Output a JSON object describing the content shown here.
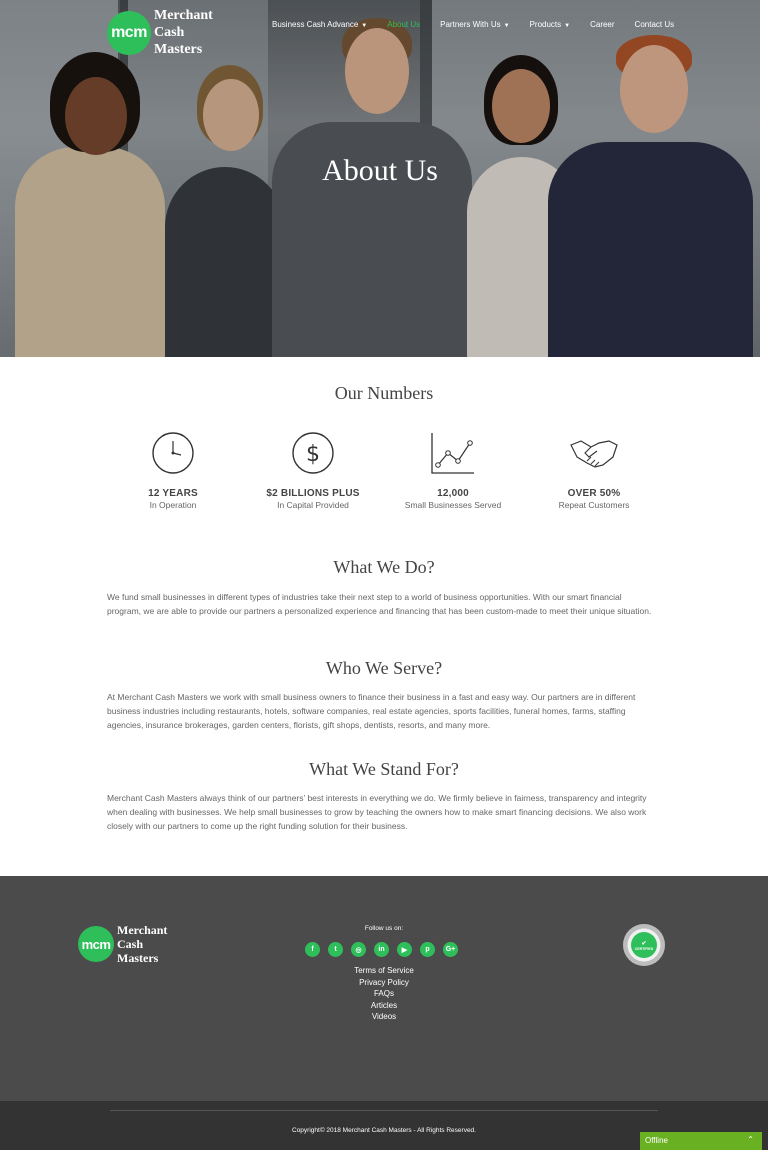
{
  "brand": {
    "logo_text": "mcm",
    "name_line1": "Merchant",
    "name_line2": "Cash",
    "name_line3": "Masters"
  },
  "nav": [
    {
      "label": "Business Cash Advance",
      "has_dropdown": true,
      "active": false
    },
    {
      "label": "About Us",
      "has_dropdown": false,
      "active": true
    },
    {
      "label": "Partners With Us",
      "has_dropdown": true,
      "active": false
    },
    {
      "label": "Products",
      "has_dropdown": true,
      "active": false
    },
    {
      "label": "Career",
      "has_dropdown": false,
      "active": false
    },
    {
      "label": "Contact Us",
      "has_dropdown": false,
      "active": false
    }
  ],
  "hero": {
    "title": "About Us"
  },
  "numbers": {
    "title": "Our Numbers",
    "stats": [
      {
        "icon": "clock-icon",
        "value": "12 YEARS",
        "label": "In Operation"
      },
      {
        "icon": "dollar-icon",
        "value": "$2 BILLIONS PLUS",
        "label": "In Capital Provided"
      },
      {
        "icon": "growth-chart-icon",
        "value": "12,000",
        "label": "Small Businesses Served"
      },
      {
        "icon": "handshake-icon",
        "value": "OVER 50%",
        "label": "Repeat Customers"
      }
    ]
  },
  "what_we_do": {
    "title": "What We Do?",
    "text": "We fund small businesses in different types of industries take their next step to a world of business opportunities. With our smart financial program, we are able to provide our partners a personalized experience and financing that has been custom-made to meet their unique situation."
  },
  "who_we_serve": {
    "title": "Who We Serve?",
    "text": "At Merchant Cash Masters we work with small business owners to finance their business in a fast and easy way. Our partners are in different business industries including restaurants, hotels, software companies, real estate agencies, sports facilities, funeral homes, farms, staffing agencies, insurance brokerages, garden centers, florists, gift shops, dentists, resorts, and many more."
  },
  "stand_for": {
    "title": "What We Stand For?",
    "text": "Merchant Cash Masters always think of our partners’ best interests in everything we do. We firmly believe in fairness, transparency and integrity when dealing with businesses. We help small businesses to grow by teaching the owners how to make smart financing decisions. We also work closely with our partners to come up the right funding solution for their business."
  },
  "footer": {
    "follow_label": "Follow us on:",
    "socials": [
      {
        "icon": "facebook-icon",
        "glyph": "f"
      },
      {
        "icon": "twitter-icon",
        "glyph": "t"
      },
      {
        "icon": "instagram-icon",
        "glyph": "◎"
      },
      {
        "icon": "linkedin-icon",
        "glyph": "in"
      },
      {
        "icon": "youtube-icon",
        "glyph": "▶"
      },
      {
        "icon": "pinterest-icon",
        "glyph": "p"
      },
      {
        "icon": "google-plus-icon",
        "glyph": "G+"
      }
    ],
    "links": [
      "Terms of Service",
      "Privacy Policy",
      "FAQs",
      "Articles",
      "Videos"
    ],
    "certified_label": "CERTIFIED",
    "copyright": "Copyright© 2018 Merchant Cash Masters - All Rights Reserved."
  },
  "chat": {
    "status": "Offline",
    "chevron": "⌃"
  },
  "colors": {
    "accent": "#2fbf5a",
    "footer_bg": "#4b4b4b",
    "bottom_bg": "#333333",
    "chat_bg": "#6ab023"
  }
}
